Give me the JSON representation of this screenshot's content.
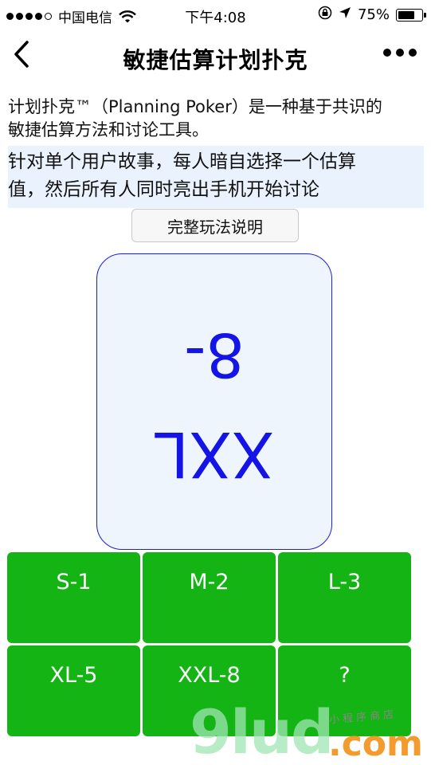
{
  "status_bar": {
    "carrier": "中国电信",
    "time": "下午4:08",
    "battery": "75%",
    "battery_level": 0.75
  },
  "nav": {
    "title": "敏捷估算计划扑克"
  },
  "intro": {
    "line1": "计划扑克™（Planning Poker）是一种基于共识的",
    "line2": "敏捷估算方法和讨论工具。"
  },
  "highlight": {
    "line1": "针对单个用户故事，每人暗自选择一个估算",
    "line2": "值，然后所有人同时亮出手机开始讨论"
  },
  "rules_button": "完整玩法说明",
  "card": {
    "value": "8-",
    "size": "XXL"
  },
  "options": [
    {
      "label": "S-1"
    },
    {
      "label": "M-2"
    },
    {
      "label": "L-3"
    },
    {
      "label": "XL-5"
    },
    {
      "label": "XXL-8"
    },
    {
      "label": "?"
    }
  ],
  "watermark": {
    "main": "9lud",
    "domain": ".com",
    "small": "小程序商店"
  },
  "colors": {
    "button_green": "#13b413",
    "card_border": "#1f1fd6",
    "card_text": "#1414e6",
    "highlight_bg": "#eaf3fd"
  }
}
